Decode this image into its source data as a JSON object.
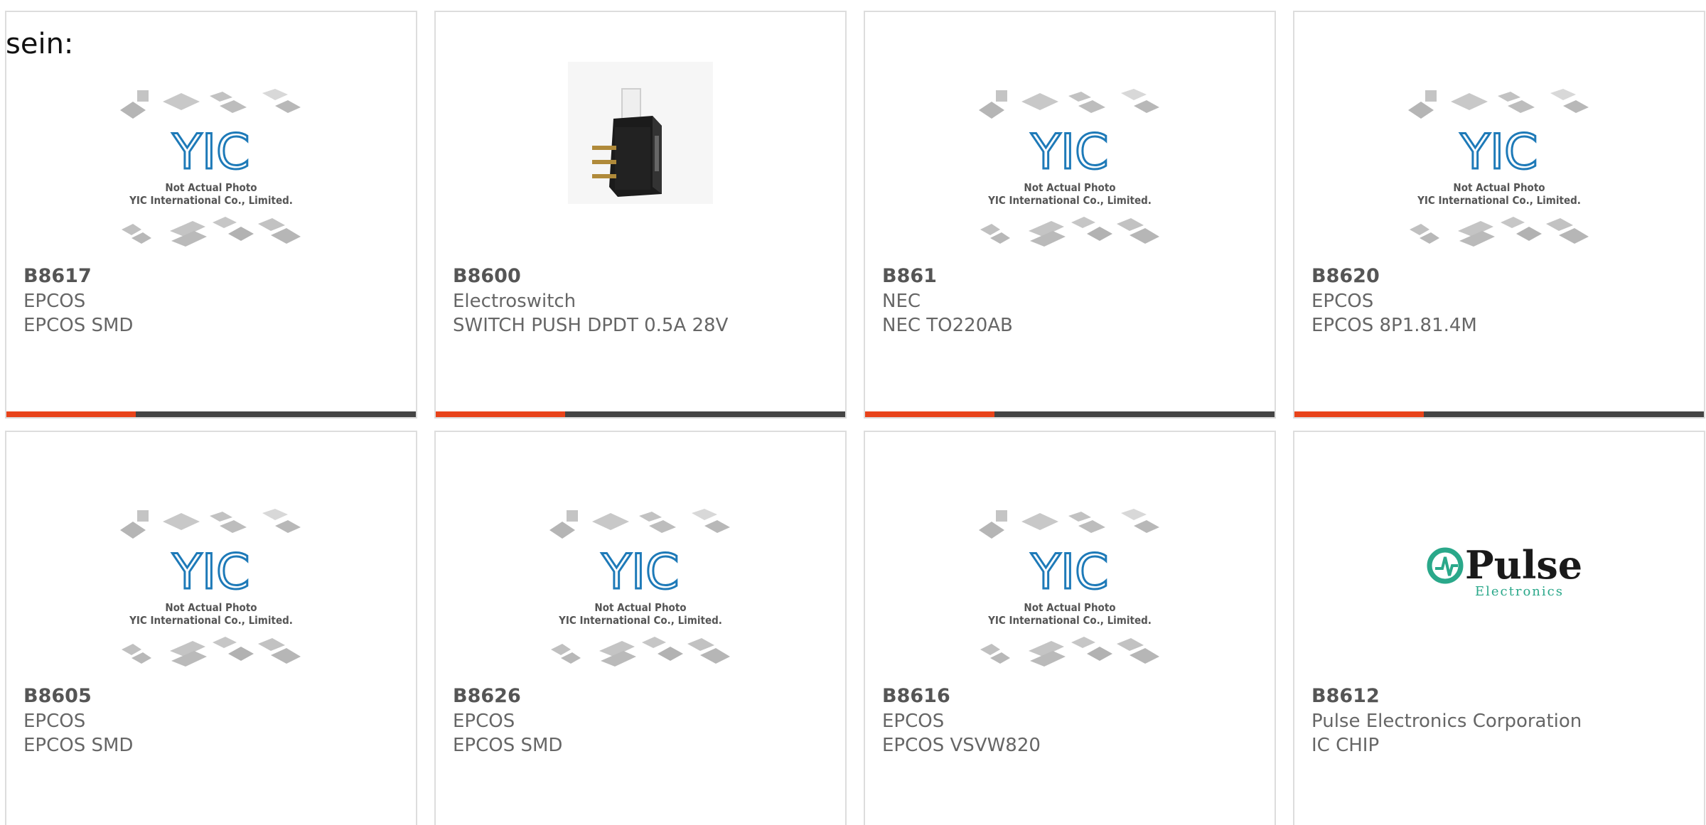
{
  "intro": {
    "text": "sein:"
  },
  "placeholder_photo": {
    "logo_text": "YIC",
    "line1": "Not Actual Photo",
    "line2": "YIC International Co., Limited."
  },
  "pulse_logo": {
    "brand": "Pulse",
    "subtitle": "Electronics"
  },
  "colors": {
    "accent_bar": "#e8431a",
    "dark_bar": "#444444",
    "card_border": "#dddddd",
    "logo_blue": "#1e7ab8",
    "pulse_teal": "#2aa88a"
  },
  "products": [
    {
      "part_number": "B8617",
      "manufacturer": "EPCOS",
      "description": "EPCOS SMD",
      "image": "placeholder",
      "has_bar": true
    },
    {
      "part_number": "B8600",
      "manufacturer": "Electroswitch",
      "description": "SWITCH PUSH DPDT 0.5A 28V",
      "image": "switch",
      "has_bar": true
    },
    {
      "part_number": "B861",
      "manufacturer": "NEC",
      "description": "NEC TO220AB",
      "image": "placeholder",
      "has_bar": true
    },
    {
      "part_number": "B8620",
      "manufacturer": "EPCOS",
      "description": "EPCOS 8P1.81.4M",
      "image": "placeholder",
      "has_bar": true
    },
    {
      "part_number": "B8605",
      "manufacturer": "EPCOS",
      "description": "EPCOS SMD",
      "image": "placeholder",
      "has_bar": false
    },
    {
      "part_number": "B8626",
      "manufacturer": "EPCOS",
      "description": "EPCOS SMD",
      "image": "placeholder",
      "has_bar": false
    },
    {
      "part_number": "B8616",
      "manufacturer": "EPCOS",
      "description": "EPCOS VSVW820",
      "image": "placeholder",
      "has_bar": false
    },
    {
      "part_number": "B8612",
      "manufacturer": "Pulse Electronics Corporation",
      "description": "IC CHIP",
      "image": "pulse",
      "has_bar": false
    }
  ]
}
